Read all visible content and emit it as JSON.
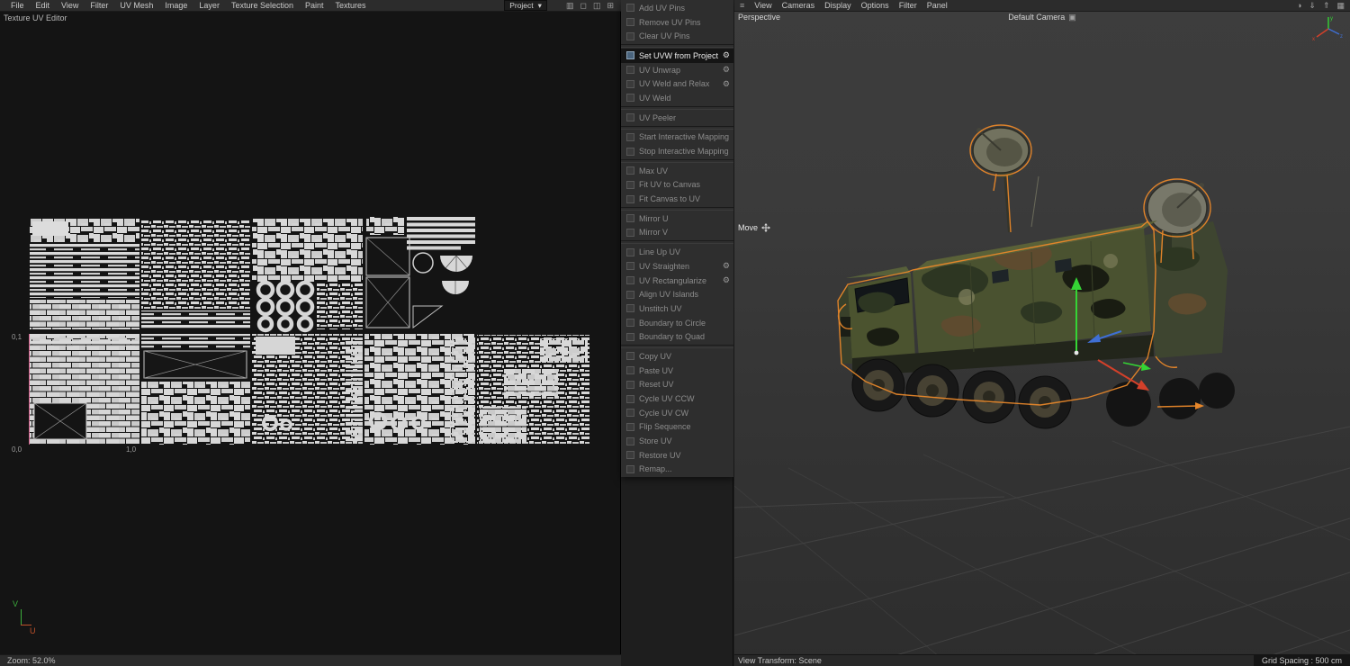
{
  "left_panel": {
    "title": "Texture UV Editor",
    "menu": [
      "File",
      "Edit",
      "View",
      "Filter",
      "UV Mesh",
      "Image",
      "Layer",
      "Texture Selection",
      "Paint",
      "Textures"
    ],
    "project_dropdown": {
      "label": "Project",
      "caret": "▾"
    },
    "toolbar_icons": [
      {
        "name": "histogram-icon",
        "glyph": "▥"
      },
      {
        "name": "lock-icon",
        "glyph": "◻"
      },
      {
        "name": "compare-panels-icon",
        "glyph": "◫"
      },
      {
        "name": "grid-icon",
        "glyph": "⊞"
      }
    ],
    "canvas": {
      "label_01": "0,1",
      "label_00": "0,0",
      "label_10": "1,0",
      "axis_v": "V",
      "axis_u": "U"
    },
    "status": {
      "zoom": "Zoom: 52.0%"
    }
  },
  "command_menu": {
    "gear_glyph": "⚙",
    "items": [
      {
        "label": "Add UV Pins"
      },
      {
        "label": "Remove UV Pins"
      },
      {
        "label": "Clear UV Pins"
      },
      {
        "label": "Set UVW from Projection",
        "active": true,
        "gear": true
      },
      {
        "label": "UV Unwrap",
        "gear": true
      },
      {
        "label": "UV Weld and Relax",
        "gear": true
      },
      {
        "label": "UV Weld"
      },
      {
        "label": "UV Peeler"
      },
      {
        "label": "Start Interactive Mapping"
      },
      {
        "label": "Stop Interactive Mapping"
      },
      {
        "label": "Max UV"
      },
      {
        "label": "Fit UV to Canvas"
      },
      {
        "label": "Fit Canvas to UV"
      },
      {
        "label": "Mirror U"
      },
      {
        "label": "Mirror V"
      },
      {
        "label": "Line Up UV"
      },
      {
        "label": "UV Straighten",
        "gear": true
      },
      {
        "label": "UV Rectangularize",
        "gear": true
      },
      {
        "label": "Align UV Islands"
      },
      {
        "label": "Unstitch UV"
      },
      {
        "label": "Boundary to Circle"
      },
      {
        "label": "Boundary to Quad"
      },
      {
        "label": "Copy UV"
      },
      {
        "label": "Paste UV"
      },
      {
        "label": "Reset UV"
      },
      {
        "label": "Cycle UV CCW"
      },
      {
        "label": "Cycle UV CW"
      },
      {
        "label": "Flip Sequence"
      },
      {
        "label": "Store UV"
      },
      {
        "label": "Restore UV"
      },
      {
        "label": "Remap..."
      }
    ]
  },
  "viewport": {
    "menu_icon": {
      "name": "hamburger-menu-icon",
      "glyph": "≡"
    },
    "menu": [
      "View",
      "Cameras",
      "Display",
      "Options",
      "Filter",
      "Panel"
    ],
    "toolbar_icons": [
      {
        "name": "color-profile-icon",
        "glyph": "◑"
      },
      {
        "name": "load-layout-icon",
        "glyph": "⇓"
      },
      {
        "name": "save-layout-icon",
        "glyph": "⇑"
      },
      {
        "name": "layout-grid-icon",
        "glyph": "▦"
      }
    ],
    "view_label": "Perspective",
    "camera_label": "Default Camera",
    "camera_icon": {
      "name": "camera-switch-icon",
      "glyph": "▣"
    },
    "tool_hint": "Move",
    "status_left": "View Transform: Scene",
    "status_right": "Grid Spacing : 500 cm"
  },
  "colors": {
    "selection_orange": "#e8872a",
    "axis_green": "#35d435",
    "axis_red": "#d4402a",
    "axis_blue": "#3f6fd4",
    "uv_pin_pink": "#cf5f8a",
    "panel_bg": "#2c2c2c",
    "canvas_bg": "#141414"
  }
}
